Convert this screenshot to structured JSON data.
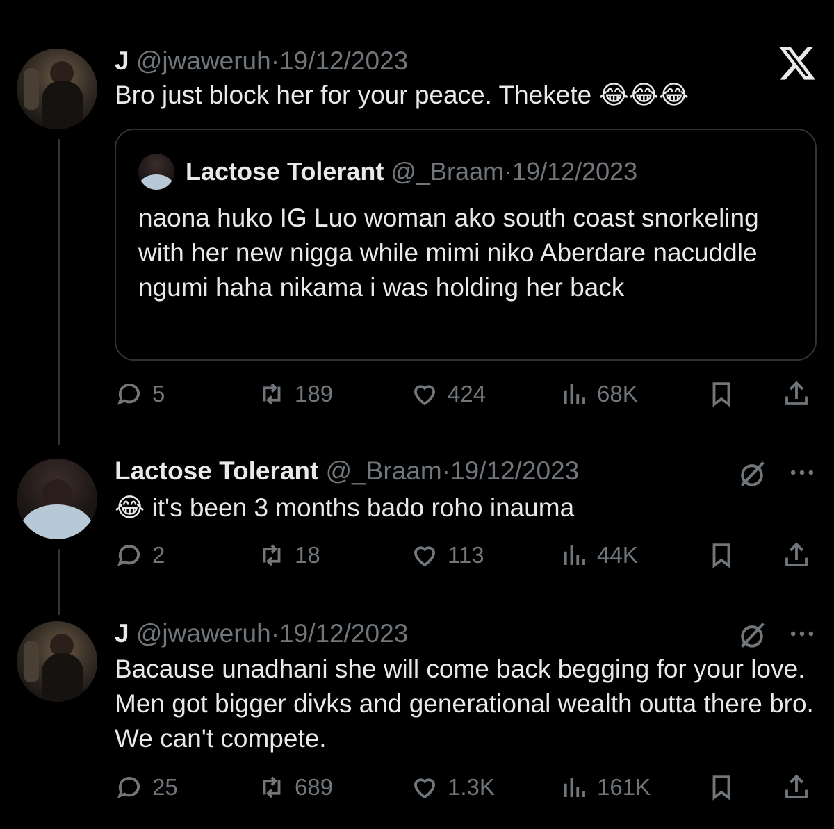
{
  "tweets": [
    {
      "name": "J",
      "handle": "@jwaweruh",
      "sep": "·",
      "date": "19/12/2023",
      "text": "Bro just block her for your peace. Thekete 😂😂😂",
      "quote": {
        "name": "Lactose Tolerant",
        "handle": "@_Braam",
        "sep": "·",
        "date": "19/12/2023",
        "text": "naona huko IG Luo woman ako south coast snorkeling with her new nigga while mimi niko Aberdare nacuddle ngumi haha nikama i was holding her back"
      },
      "stats": {
        "replies": "5",
        "reposts": "189",
        "likes": "424",
        "views": "68K"
      }
    },
    {
      "name": "Lactose Tolerant",
      "handle": "@_Braam",
      "sep": "·",
      "date": "19/12/2023",
      "text": "😂 it's been 3 months bado roho inauma",
      "stats": {
        "replies": "2",
        "reposts": "18",
        "likes": "113",
        "views": "44K"
      }
    },
    {
      "name": "J",
      "handle": "@jwaweruh",
      "sep": "·",
      "date": "19/12/2023",
      "text": "Bacause unadhani she will come back begging for your love. Men got bigger divks and generational wealth outta there bro. We can't compete.",
      "stats": {
        "replies": "25",
        "reposts": "689",
        "likes": "1.3K",
        "views": "161K"
      }
    }
  ],
  "icons": {
    "close": "x-logo-icon",
    "reply": "reply-icon",
    "repost": "repost-icon",
    "like": "heart-icon",
    "views": "views-icon",
    "bookmark": "bookmark-icon",
    "share": "share-icon",
    "grok": "grok-icon",
    "more": "more-icon"
  },
  "colors": {
    "background": "#000000",
    "text": "#e7e9ea",
    "muted": "#71767b",
    "border": "#2f3336"
  }
}
